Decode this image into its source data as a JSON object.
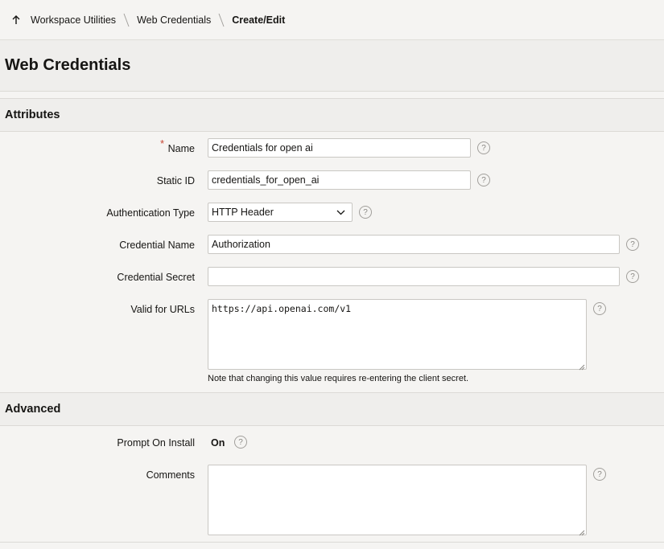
{
  "breadcrumb": {
    "items": [
      "Workspace Utilities",
      "Web Credentials"
    ],
    "current": "Create/Edit"
  },
  "page": {
    "title": "Web Credentials"
  },
  "attributes": {
    "header": "Attributes",
    "name": {
      "label": "Name",
      "required_mark": "*",
      "value": "Credentials for open ai"
    },
    "static_id": {
      "label": "Static ID",
      "value": "credentials_for_open_ai"
    },
    "auth_type": {
      "label": "Authentication Type",
      "value": "HTTP Header"
    },
    "credential_name": {
      "label": "Credential Name",
      "value": "Authorization"
    },
    "credential_secret": {
      "label": "Credential Secret",
      "value": ""
    },
    "valid_urls": {
      "label": "Valid for URLs",
      "value": "https://api.openai.com/v1",
      "note": "Note that changing this value requires re-entering the client secret."
    }
  },
  "advanced": {
    "header": "Advanced",
    "prompt_on_install": {
      "label": "Prompt On Install",
      "value": "On"
    },
    "comments": {
      "label": "Comments",
      "value": ""
    }
  },
  "help_glyph": "?",
  "icons": {
    "up": "arrow-up-icon",
    "separator": "breadcrumb-separator-icon",
    "help": "help-icon",
    "chevron": "chevron-down-icon"
  }
}
